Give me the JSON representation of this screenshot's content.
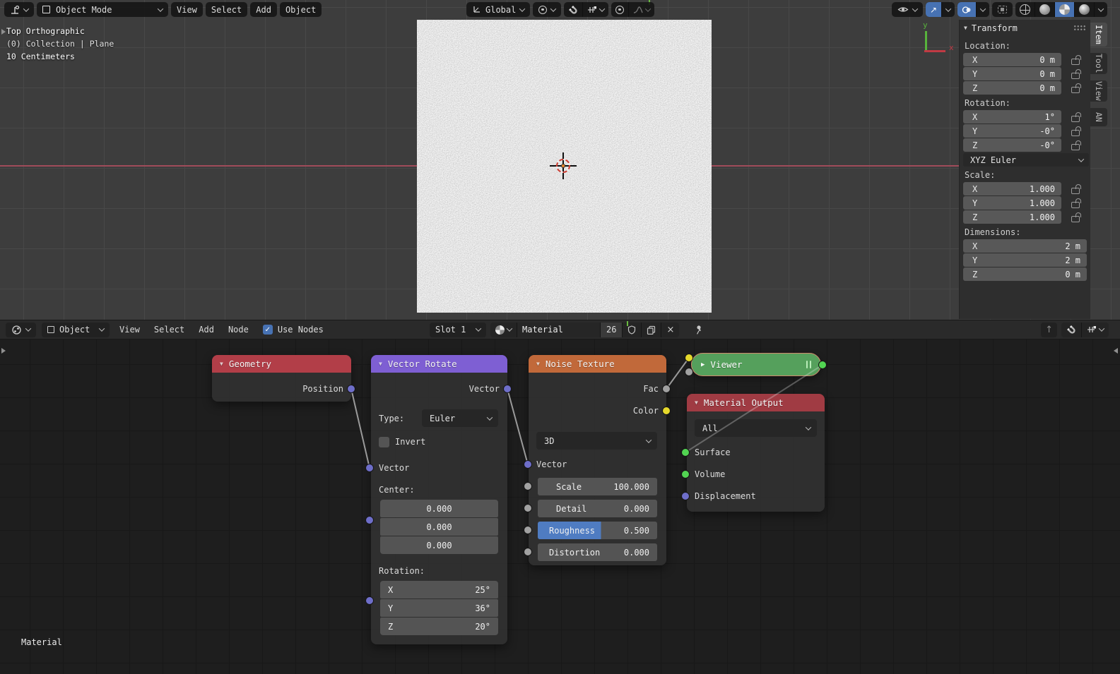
{
  "viewport": {
    "header": {
      "mode": "Object Mode",
      "menu_view": "View",
      "menu_select": "Select",
      "menu_add": "Add",
      "menu_object": "Object",
      "orientation": "Global"
    },
    "overlay": {
      "line1": "Top Orthographic",
      "line2": "(0) Collection | Plane",
      "line3": "10 Centimeters"
    },
    "gizmo": {
      "x": "x",
      "y": "y"
    },
    "sidebar": {
      "tabs": [
        "Item",
        "Tool",
        "View",
        "AN"
      ],
      "panel_title": "Transform",
      "location": {
        "label": "Location:",
        "rows": [
          {
            "axis": "X",
            "value": "0 m"
          },
          {
            "axis": "Y",
            "value": "0 m"
          },
          {
            "axis": "Z",
            "value": "0 m"
          }
        ]
      },
      "rotation": {
        "label": "Rotation:",
        "rows": [
          {
            "axis": "X",
            "value": "1°"
          },
          {
            "axis": "Y",
            "value": "-0°"
          },
          {
            "axis": "Z",
            "value": "-0°"
          }
        ],
        "mode": "XYZ Euler"
      },
      "scale": {
        "label": "Scale:",
        "rows": [
          {
            "axis": "X",
            "value": "1.000"
          },
          {
            "axis": "Y",
            "value": "1.000"
          },
          {
            "axis": "Z",
            "value": "1.000"
          }
        ]
      },
      "dimensions": {
        "label": "Dimensions:",
        "rows": [
          {
            "axis": "X",
            "value": "2 m"
          },
          {
            "axis": "Y",
            "value": "2 m"
          },
          {
            "axis": "Z",
            "value": "0 m"
          }
        ]
      }
    }
  },
  "node_editor": {
    "header": {
      "object": "Object",
      "menu_view": "View",
      "menu_select": "Select",
      "menu_add": "Add",
      "menu_node": "Node",
      "use_nodes": "Use Nodes",
      "slot": "Slot 1",
      "material_name": "Material",
      "user_count": "26"
    },
    "overlay_label": "Material",
    "nodes": {
      "geometry": {
        "title": "Geometry",
        "output": "Position"
      },
      "vector_rotate": {
        "title": "Vector Rotate",
        "output": "Vector",
        "type_label": "Type:",
        "type_value": "Euler",
        "invert": "Invert",
        "input_vector": "Vector",
        "center_label": "Center:",
        "center": [
          "0.000",
          "0.000",
          "0.000"
        ],
        "rotation_label": "Rotation:",
        "rotation": [
          {
            "axis": "X",
            "value": "25°"
          },
          {
            "axis": "Y",
            "value": "36°"
          },
          {
            "axis": "Z",
            "value": "20°"
          }
        ]
      },
      "noise_texture": {
        "title": "Noise Texture",
        "out_fac": "Fac",
        "out_color": "Color",
        "dimensions": "3D",
        "input_vector": "Vector",
        "params": [
          {
            "label": "Scale",
            "value": "100.000"
          },
          {
            "label": "Detail",
            "value": "0.000"
          },
          {
            "label": "Roughness",
            "value": "0.500"
          },
          {
            "label": "Distortion",
            "value": "0.000"
          }
        ]
      },
      "viewer": {
        "title": "Viewer"
      },
      "material_output": {
        "title": "Material Output",
        "target": "All",
        "inputs": [
          "Surface",
          "Volume",
          "Displacement"
        ]
      }
    }
  },
  "colors": {
    "accent": "#4772b3",
    "node_geometry": "#b23e48",
    "node_vector_rotate": "#7e5fd3",
    "node_noise": "#c1693a",
    "node_viewer": "#55a05c",
    "node_material_output": "#a03b43",
    "socket_vector": "#6e6ec9",
    "socket_value": "#a1a1a1",
    "socket_color": "#e6d92c",
    "socket_shader": "#52d452",
    "axis_x": "#a04b5a"
  }
}
